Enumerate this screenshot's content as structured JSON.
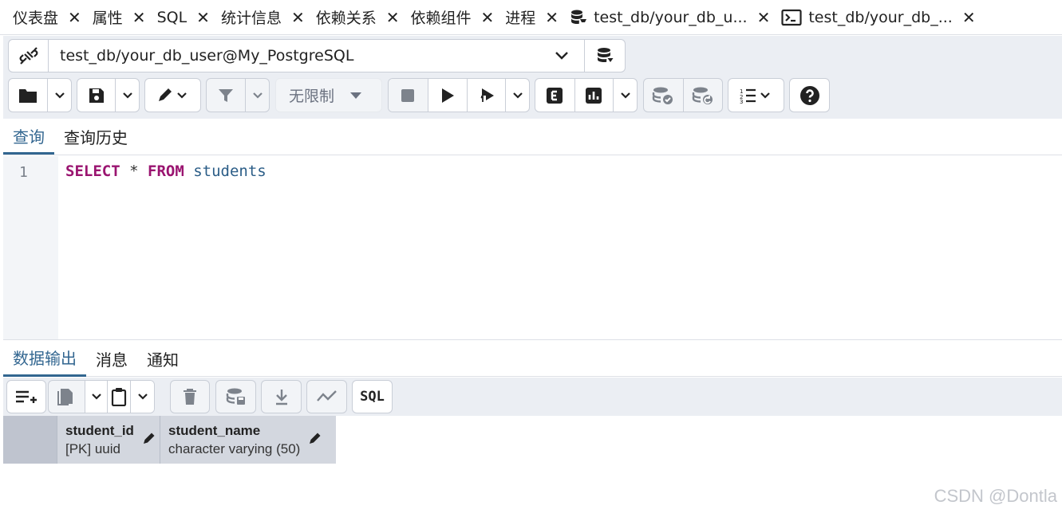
{
  "tabs": [
    {
      "label": "仪表盘"
    },
    {
      "label": "属性"
    },
    {
      "label": "SQL"
    },
    {
      "label": "统计信息"
    },
    {
      "label": "依赖关系"
    },
    {
      "label": "依赖组件"
    },
    {
      "label": "进程"
    },
    {
      "label": "test_db/your_db_u...",
      "icon": "database-icon"
    },
    {
      "label": "test_db/your_db_...",
      "icon": "terminal-icon"
    }
  ],
  "close_glyph": "✕",
  "connection": {
    "value": "test_db/your_db_user@My_PostgreSQL"
  },
  "toolbar": {
    "limit_label": "无限制"
  },
  "query_tabs": [
    {
      "label": "查询"
    },
    {
      "label": "查询历史"
    }
  ],
  "editor": {
    "line_number": "1",
    "tokens": {
      "select": "SELECT",
      "star": "*",
      "from": "FROM",
      "table": "students"
    }
  },
  "result_tabs": [
    {
      "label": "数据输出"
    },
    {
      "label": "消息"
    },
    {
      "label": "通知"
    }
  ],
  "result_toolbar": {
    "sql_label": "SQL"
  },
  "grid": {
    "columns": [
      {
        "name": "student_id",
        "type": "[PK] uuid"
      },
      {
        "name": "student_name",
        "type": "character varying (50)"
      }
    ]
  },
  "watermark": "CSDN @Dontla",
  "colors": {
    "accent": "#326690",
    "keyword": "#9a1470",
    "identifier": "#2b5d87",
    "panel": "#ebeef3"
  }
}
